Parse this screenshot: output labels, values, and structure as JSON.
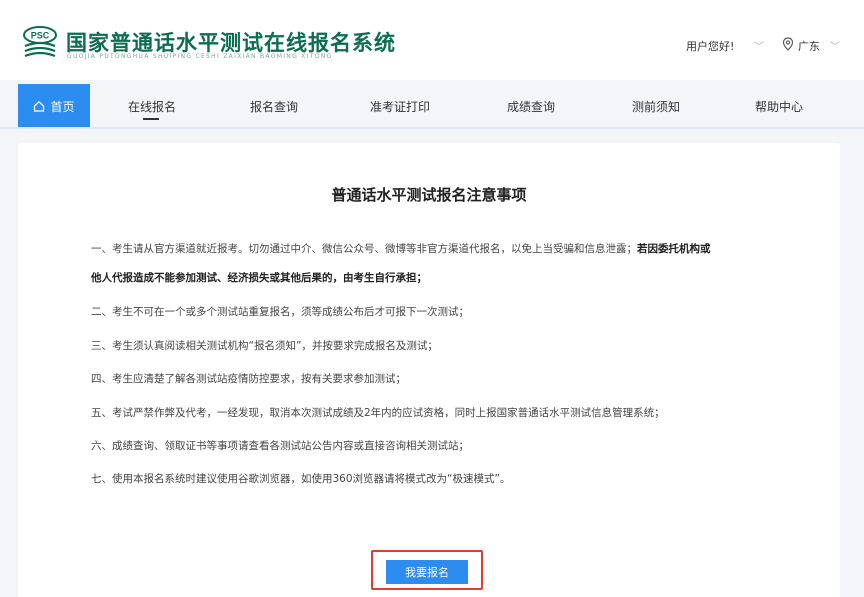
{
  "header": {
    "site_title": "国家普通话水平测试在线报名系统",
    "site_subtitle": "GUOJIA PUTONGHUA SHUIPING CESHI ZAIXIAN BAOMING XITONG",
    "logo_text": "PSC",
    "user_greeting": "用户您好!",
    "location": "广东",
    "brand_color": "#0b6e4f"
  },
  "nav": {
    "accent": "#2d8cf0",
    "home_label": "首页",
    "items": [
      {
        "label": "在线报名",
        "active": true
      },
      {
        "label": "报名查询"
      },
      {
        "label": "准考证打印"
      },
      {
        "label": "成绩查询"
      },
      {
        "label": "测前须知"
      },
      {
        "label": "帮助中心"
      }
    ]
  },
  "notice": {
    "title": "普通话水平测试报名注意事项",
    "rule1_normal": "一、考生请从官方渠道就近报考。切勿通过中介、微信公众号、微博等非官方渠道代报名，以免上当受骗和信息泄露；",
    "rule1_bold": "若因委托机构或",
    "rule1_cont": "他人代报造成不能参加测试、经济损失或其他后果的，由考生自行承担；",
    "rules": [
      "二、考生不可在一个或多个测试站重复报名，须等成绩公布后才可报下一次测试；",
      "三、考生须认真阅读相关测试机构“报名须知”，并按要求完成报名及测试；",
      "四、考生应清楚了解各测试站疫情防控要求，按有关要求参加测试；",
      "五、考试严禁作弊及代考，一经发现，取消本次测试成绩及2年内的应试资格，同时上报国家普通话水平测试信息管理系统；",
      "六、成绩查询、领取证书等事项请查看各测试站公告内容或直接咨询相关测试站；",
      "七、使用本报名系统时建议使用谷歌浏览器，如使用360浏览器请将模式改为“极速模式”。"
    ],
    "apply_button": "我要报名"
  }
}
